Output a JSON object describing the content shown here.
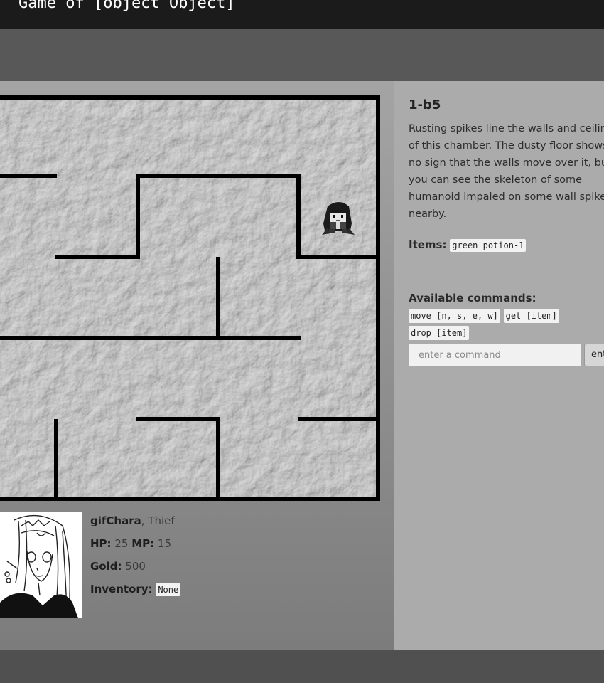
{
  "app": {
    "title": "Game of [object Object]"
  },
  "room": {
    "name": "1-b5",
    "description": "Rusting spikes line the walls and ceiling of this chamber. The dusty floor shows no sign that the walls move over it, but you can see the skeleton of some humanoid impaled on some wall spikes nearby.",
    "items_label": "Items:",
    "items": [
      "green_potion-1"
    ]
  },
  "commands": {
    "title": "Available commands:",
    "list": [
      "move [n, s, e, w]",
      "get [item]",
      "drop [item]"
    ],
    "input_placeholder": "enter a command",
    "enter_label": "enter"
  },
  "character": {
    "name": "gifChara",
    "class": "Thief",
    "hp_label": "HP:",
    "hp": "25",
    "mp_label": "MP:",
    "mp": "15",
    "gold_label": "Gold:",
    "gold": "500",
    "inventory_label": "Inventory:",
    "inventory": "None"
  },
  "colors": {
    "topbar": "#1b1b1b",
    "left_panel": "#8e8e8e",
    "right_panel": "#ababab",
    "wall": "#000000",
    "floor": "#a9a9a9"
  },
  "icons": {
    "player": "player-sprite-icon",
    "portrait": "character-portrait"
  }
}
